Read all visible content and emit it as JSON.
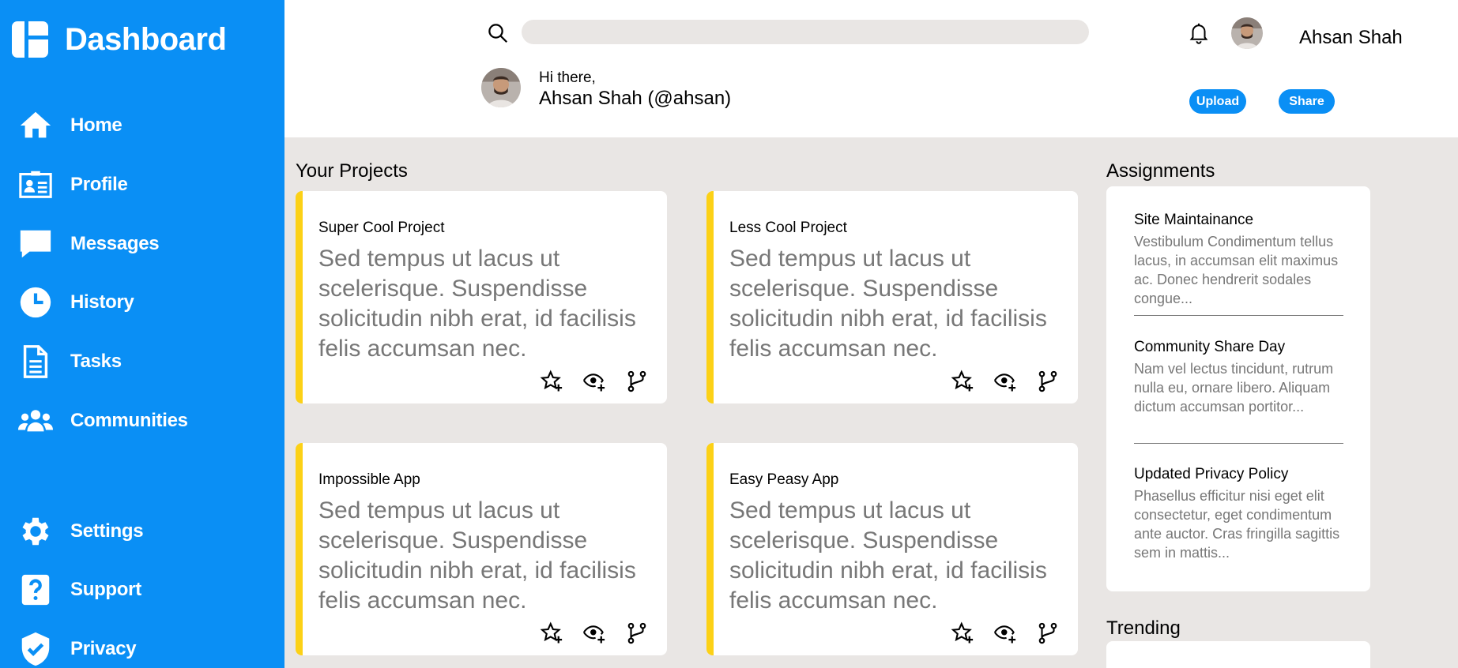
{
  "sidebar": {
    "brand": "Dashboard",
    "items": [
      {
        "label": "Home",
        "icon": "home-icon"
      },
      {
        "label": "Profile",
        "icon": "id-card-icon"
      },
      {
        "label": "Messages",
        "icon": "message-icon"
      },
      {
        "label": "History",
        "icon": "clock-icon"
      },
      {
        "label": "Tasks",
        "icon": "document-icon"
      },
      {
        "label": "Communities",
        "icon": "people-icon"
      },
      {
        "label": "Settings",
        "icon": "gear-icon"
      },
      {
        "label": "Support",
        "icon": "help-icon"
      },
      {
        "label": "Privacy",
        "icon": "shield-icon"
      }
    ]
  },
  "header": {
    "search_placeholder": "",
    "user_name": "Ahsan Shah",
    "greeting": "Hi there,",
    "greeting_name": "Ahsan Shah (@ahsan)",
    "upload_label": "Upload",
    "share_label": "Share"
  },
  "projects": {
    "title": "Your Projects",
    "cards": [
      {
        "title": "Super Cool Project",
        "body": "Sed tempus ut lacus ut scelerisque. Suspendisse solicitudin nibh erat, id facilisis felis accumsan nec."
      },
      {
        "title": "Less Cool Project",
        "body": "Sed tempus ut lacus ut scelerisque. Suspendisse solicitudin nibh erat, id facilisis felis accumsan nec."
      },
      {
        "title": "Impossible App",
        "body": "Sed tempus ut lacus ut scelerisque. Suspendisse solicitudin nibh erat, id facilisis felis accumsan nec."
      },
      {
        "title": "Easy Peasy App",
        "body": "Sed tempus ut lacus ut scelerisque. Suspendisse solicitudin nibh erat, id facilisis felis accumsan nec."
      }
    ]
  },
  "assignments": {
    "title": "Assignments",
    "items": [
      {
        "title": "Site Maintainance",
        "body": "Vestibulum Condimentum tellus lacus, in accumsan elit maximus ac. Donec hendrerit sodales congue..."
      },
      {
        "title": "Community Share Day",
        "body": "Nam vel lectus tincidunt, rutrum nulla eu, ornare libero. Aliquam dictum accumsan portitor..."
      },
      {
        "title": "Updated Privacy Policy",
        "body": "Phasellus efficitur nisi eget elit consectetur, eget condimentum ante auctor. Cras fringilla sagittis sem in mattis..."
      }
    ]
  },
  "trending": {
    "title": "Trending"
  },
  "colors": {
    "accent": "#0a8ff5",
    "card_stripe": "#fcd116",
    "background": "#e9e6e4"
  }
}
